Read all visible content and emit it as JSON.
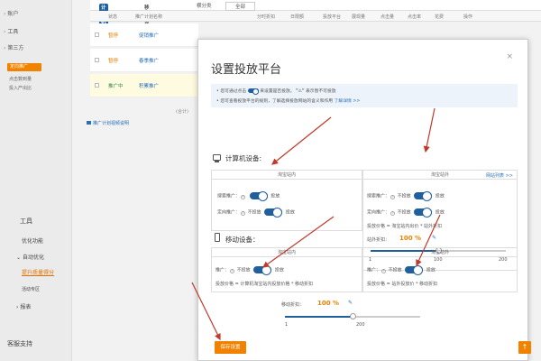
{
  "sidebar": {
    "account": "账户",
    "tools": "工具",
    "third_party": "第三方",
    "active": "定向推广",
    "sub1": "点击数到量",
    "sub2": "投入产出比",
    "tools_group": "工具",
    "optimize": "优化功能",
    "auto_opt": "自动优化",
    "quality": "提升质量得分",
    "campaign": "活动专区",
    "report": "报表",
    "support": "客服支持"
  },
  "topbar": {
    "pc": "计算机",
    "mobile": "移动设备",
    "plan_type": "横分类",
    "all": "全部"
  },
  "columns": [
    "状态",
    "推广计划名称",
    "分时折扣",
    "日限额",
    "投放平台",
    "展现量",
    "点击量",
    "点击率",
    "花费",
    "操作"
  ],
  "rows": [
    {
      "status": "暂停",
      "name": "促销推广"
    },
    {
      "status": "暂停",
      "name": "春季推广"
    },
    {
      "status": "推广中",
      "name": "积累推广"
    }
  ],
  "total_label": "(合计)",
  "plan_link": "推广计划视频说明",
  "modal": {
    "title": "设置投放平台",
    "close": "×",
    "tip1_a": "您可通过点击",
    "tip1_b": "来设置是否投放，",
    "tip1_c": "表示暂不可投放",
    "tip2": "您可查看投放平台的规则，了解选择投放网站的含义和作用",
    "tip2_link": "了解详情 >>",
    "pc_label": "计算机设备:",
    "pc_left_head": "淘宝站内",
    "pc_right_head": "淘宝站外",
    "pc_right_link": "网站列表 >>",
    "search_promo": "搜索推广：",
    "targeted_promo": "定向推广：",
    "no_launch": "不投放",
    "launch": "投放",
    "price_formula": "投放价格 = 淘宝站内出价 * 站外折扣",
    "bid_label": "站外折扣：",
    "bid_value": "100 %",
    "pc_slider_min": "1",
    "pc_slider_mid": "100",
    "pc_slider_max": "200",
    "pc_slider_pct": 0.5,
    "mobile_label": "移动设备：",
    "mob_left_head": "淘宝站内",
    "mob_right_head": "淘宝站外",
    "promo": "推广：",
    "mob_price_left": "投放价格 = 计算机淘宝站内投放价格 * 移动折扣",
    "mob_price_right": "投放价格 = 站外投放价 * 移动折扣",
    "mob_bid_label": "移动折扣：",
    "mob_bid_value": "100 %",
    "mob_slider_min": "1",
    "mob_slider_max": "200",
    "mob_slider_pct": 0.5,
    "save": "保存设置"
  },
  "up_icon": "↑"
}
